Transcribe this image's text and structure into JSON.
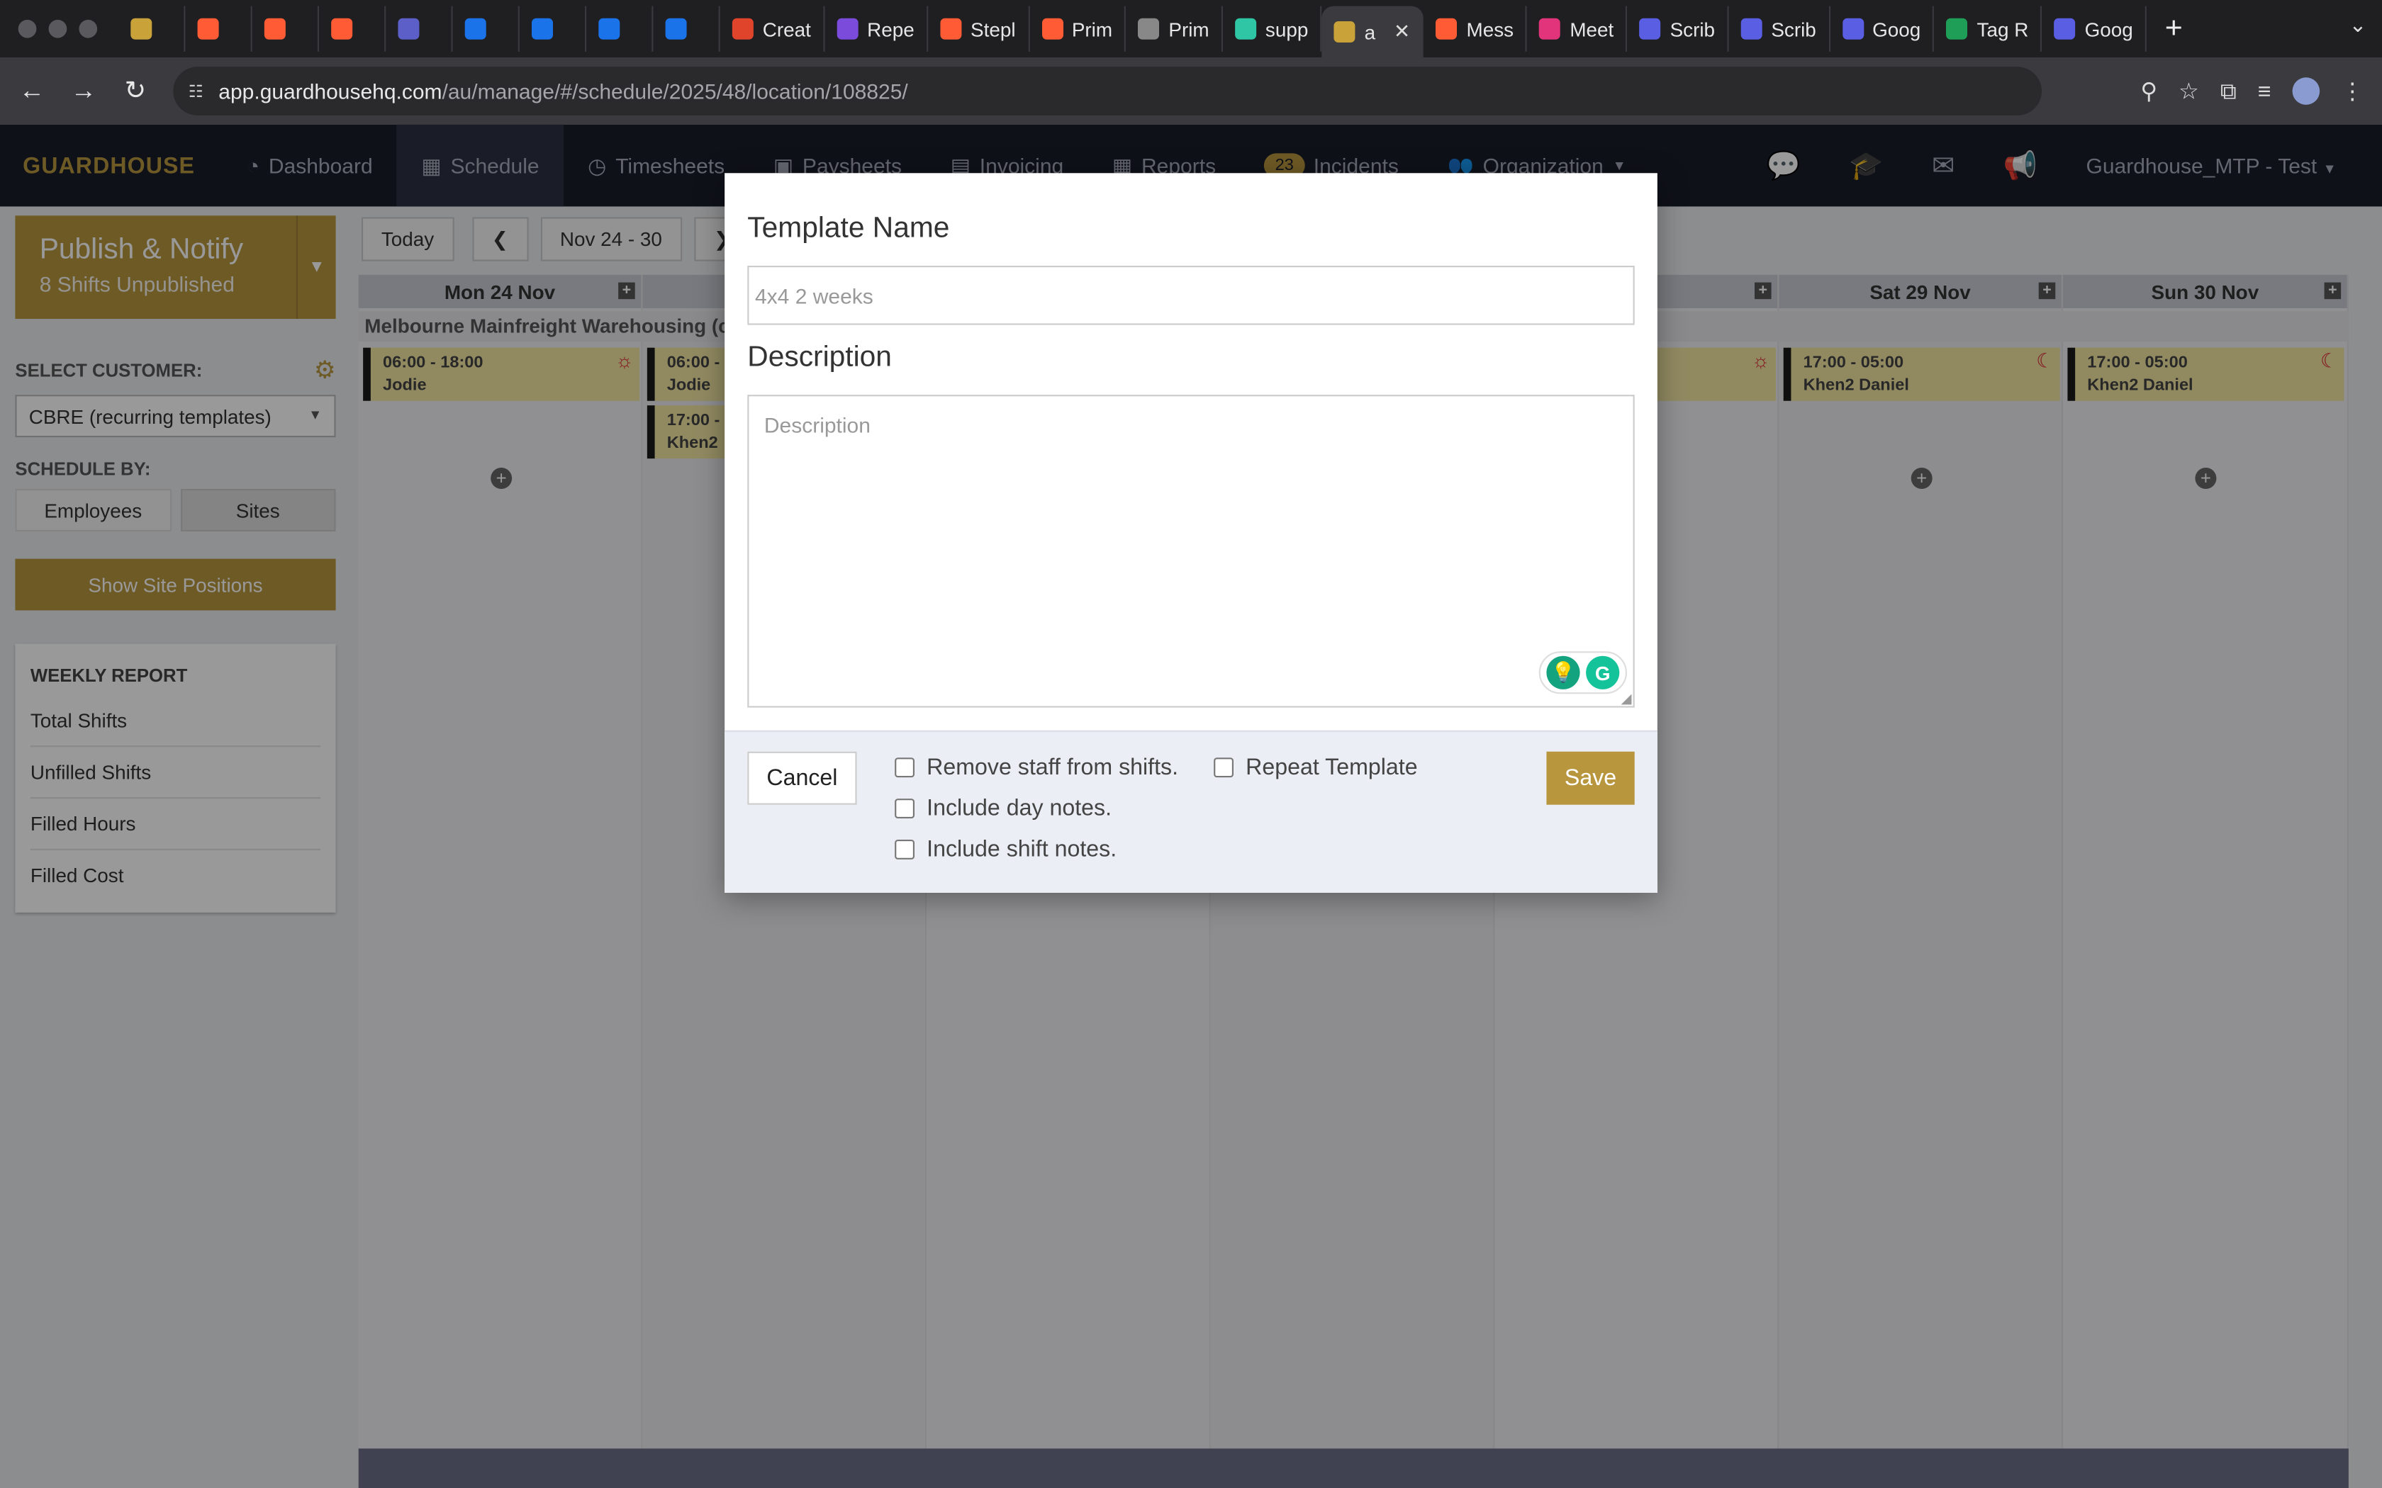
{
  "browser": {
    "tabs": [
      {
        "label": "",
        "color": "#c9a23a"
      },
      {
        "label": "",
        "color": "#ff5c35"
      },
      {
        "label": "",
        "color": "#ff5c35"
      },
      {
        "label": "",
        "color": "#ff5c35"
      },
      {
        "label": "",
        "color": "#5b5fc7"
      },
      {
        "label": "",
        "color": "#1a73e8"
      },
      {
        "label": "",
        "color": "#1a73e8"
      },
      {
        "label": "",
        "color": "#1a73e8"
      },
      {
        "label": "",
        "color": "#1a73e8"
      },
      {
        "label": "Creat",
        "color": "#e0452c"
      },
      {
        "label": "Repe",
        "color": "#7b4bdc"
      },
      {
        "label": "Stepl",
        "color": "#ff5c35"
      },
      {
        "label": "Prim",
        "color": "#ff5c35"
      },
      {
        "label": "Prim",
        "color": "#888888"
      },
      {
        "label": "supp",
        "color": "#2fc6a6"
      },
      {
        "label": "a",
        "color": "#c9a23a",
        "active": true
      },
      {
        "label": "Mess",
        "color": "#ff5c35"
      },
      {
        "label": "Meet",
        "color": "#e2347a"
      },
      {
        "label": "Scrib",
        "color": "#5a5ee3"
      },
      {
        "label": "Scrib",
        "color": "#5a5ee3"
      },
      {
        "label": "Goog",
        "color": "#5a5ee3"
      },
      {
        "label": "Tag R",
        "color": "#1e9e57"
      },
      {
        "label": "Goog",
        "color": "#5a5ee3"
      }
    ],
    "url_host": "app.guardhousehq.com",
    "url_path": "/au/manage/#/schedule/2025/48/location/108825/"
  },
  "app": {
    "brand": "GUARDHOUSE",
    "nav": [
      {
        "label": "Dashboard",
        "icon": "dashboard-icon",
        "glyph": "◔"
      },
      {
        "label": "Schedule",
        "icon": "calendar-icon",
        "glyph": "▦",
        "active": true
      },
      {
        "label": "Timesheets",
        "icon": "clock-icon",
        "glyph": "◷"
      },
      {
        "label": "Paysheets",
        "icon": "money-icon",
        "glyph": "▣"
      },
      {
        "label": "Invoicing",
        "icon": "invoice-icon",
        "glyph": "▤"
      },
      {
        "label": "Reports",
        "icon": "table-icon",
        "glyph": "▦"
      }
    ],
    "incidents_count": "23",
    "incidents_label": "Incidents",
    "organization_label": "Organization",
    "user_label": "Guardhouse_MTP - Test"
  },
  "sidebar": {
    "publish_title": "Publish & Notify",
    "publish_sub": "8 Shifts Unpublished",
    "select_customer_label": "SELECT CUSTOMER:",
    "customer_value": "CBRE (recurring templates)",
    "schedule_by_label": "SCHEDULE BY:",
    "schedule_by_options": [
      "Employees",
      "Sites"
    ],
    "show_site_positions": "Show Site Positions",
    "weekly_report_title": "WEEKLY REPORT",
    "weekly_report_items": [
      "Total Shifts",
      "Unfilled Shifts",
      "Filled Hours",
      "Filled Cost"
    ]
  },
  "schedule": {
    "today": "Today",
    "range": "Nov 24 - 30",
    "days": [
      "Mon 24 Nov",
      "",
      "",
      "",
      "ov",
      "Sat 29 Nov",
      "Sun 30 Nov"
    ],
    "site_name": "Melbourne Mainfreight Warehousing (cu",
    "shifts": {
      "mon": {
        "time": "06:00 - 18:00",
        "name": "Jodie"
      },
      "tue1": {
        "time": "06:00 -",
        "name": "Jodie"
      },
      "tue2": {
        "time": "17:00 -",
        "name": "Khen2"
      },
      "sat": {
        "time": "17:00 - 05:00",
        "name": "Khen2 Daniel"
      },
      "sun": {
        "time": "17:00 - 05:00",
        "name": "Khen2 Daniel"
      }
    }
  },
  "modal": {
    "template_name_label": "Template Name",
    "template_name_placeholder": "4x4 2 weeks",
    "description_label": "Description",
    "description_placeholder": "Description",
    "cancel": "Cancel",
    "checkboxes": {
      "remove_staff": "Remove staff from shifts.",
      "day_notes": "Include day notes.",
      "shift_notes": "Include shift notes.",
      "repeat": "Repeat Template"
    },
    "save": "Save"
  },
  "colors": {
    "accent": "#b8963e",
    "nav_bg": "#1a1d2b",
    "shift_bg": "#f2e6a2"
  }
}
